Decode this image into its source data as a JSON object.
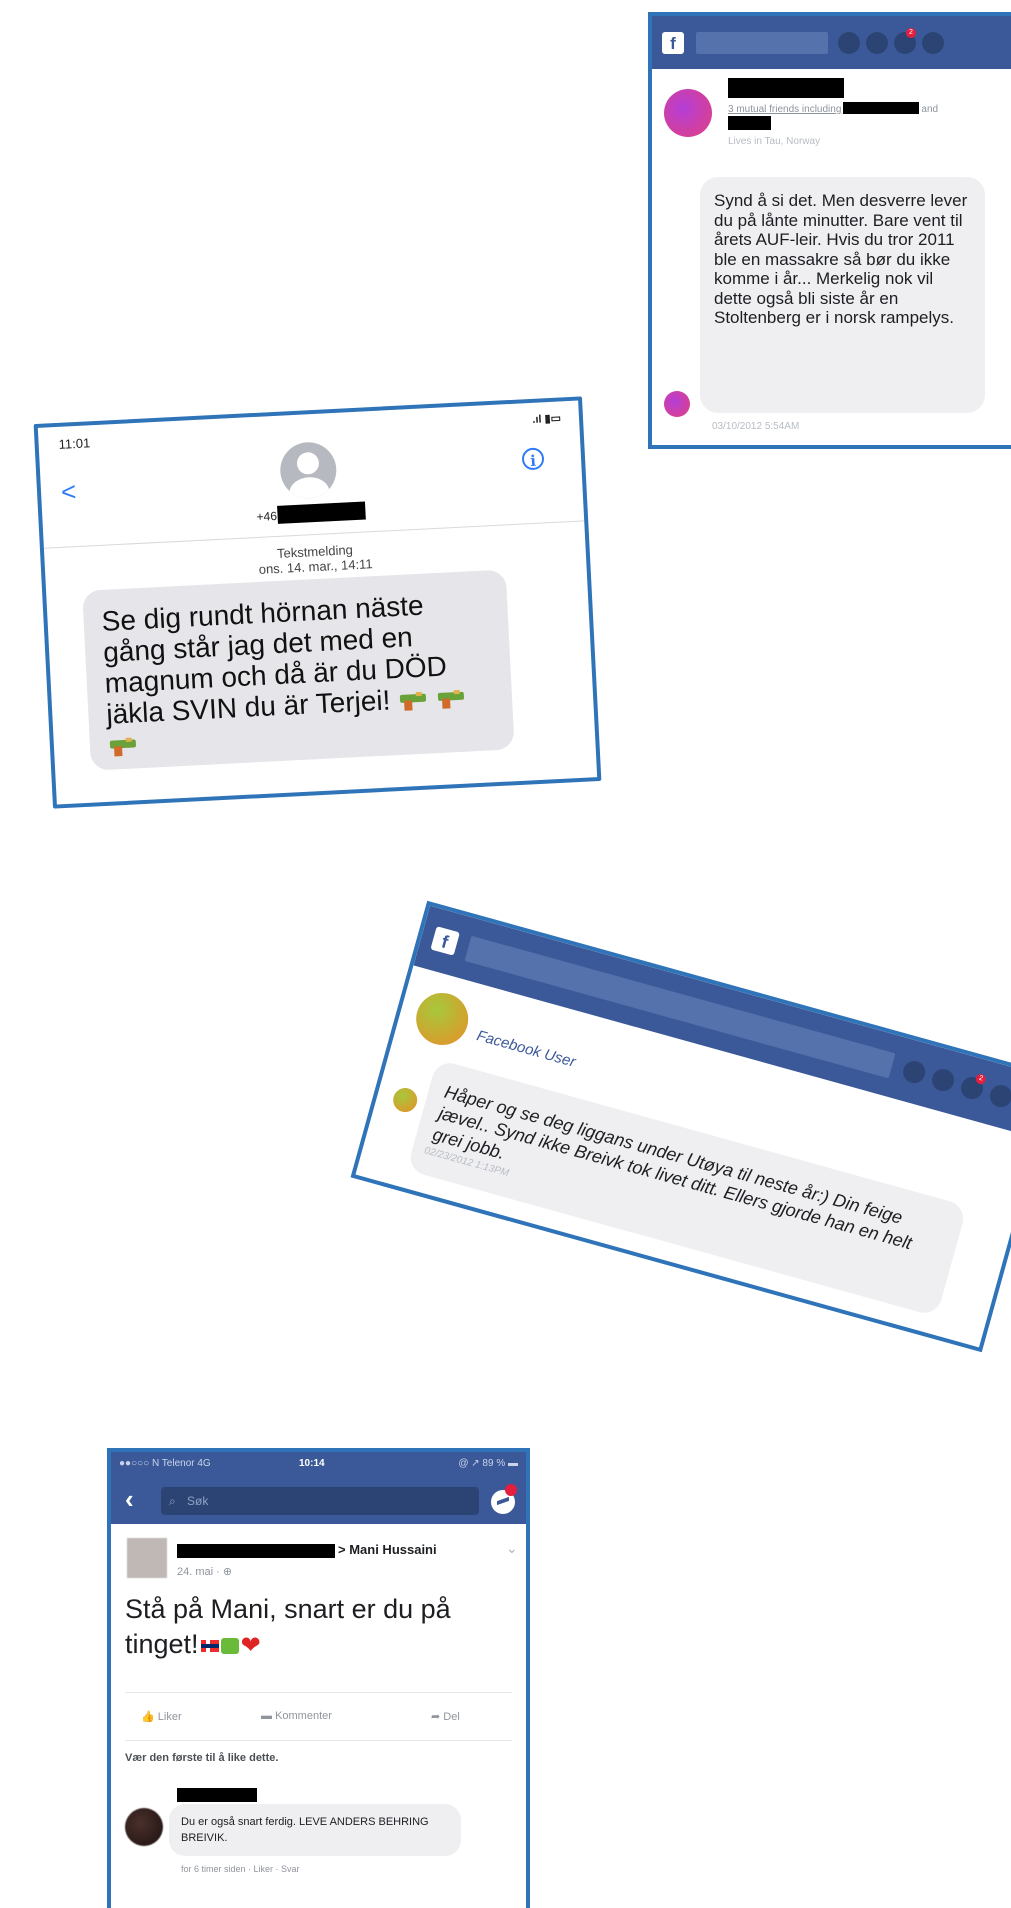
{
  "card1": {
    "mutual_text": "3 mutual friends including",
    "mutual_suffix": "and",
    "lives": "Lives in Tau, Norway",
    "message": "Synd å si det. Men desverre lever du på lånte minutter. Bare vent til årets AUF-leir. Hvis du tror 2011 ble en massakre så bør du ikke komme i år... Merkelig nok vil dette også bli siste år en Stoltenberg er i norsk rampelys.",
    "timestamp": "03/10/2012 5:54AM",
    "badge": "2"
  },
  "card2": {
    "status_time": "11:01",
    "signal": ".ıl ▮▭",
    "number_prefix": "+46",
    "meta_line1": "Tekstmelding",
    "meta_line2": "ons. 14. mar., 14:11",
    "message": "Se dig rundt hörnan näste gång står jag det med en magnum och då är du DÖD jäkla SVIN du är Terjei!",
    "info_label": "i",
    "back_label": "<"
  },
  "card3": {
    "user": "Facebook User",
    "message": "Håper og se deg liggans under Utøya til neste år:) Din feige jævel.. Synd ikke Breivk tok livet ditt. Ellers gjorde han en helt grei jobb.",
    "timestamp": "02/23/2012 1:13PM",
    "badge": "2"
  },
  "card4": {
    "status_left": "●●○○○ N Telenor  4G",
    "status_time": "10:14",
    "status_right": "@ ↗ 89 % ▬",
    "search_placeholder": "Søk",
    "back_label": "‹",
    "recipient": "> Mani Hussaini",
    "date": "24. mai · ⊕",
    "post_text": "Stå på Mani, snart er du på tinget!",
    "like_label": "Liker",
    "comment_label": "Kommenter",
    "share_label": "Del",
    "first_like": "Vær den første til å like dette.",
    "comment_text": "Du er også snart ferdig. LEVE ANDERS BEHRING BREIVIK.",
    "comment_meta": "for 6 timer siden · Liker · Svar"
  }
}
